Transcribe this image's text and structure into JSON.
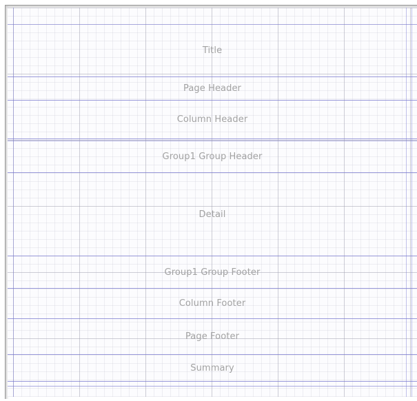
{
  "designer": {
    "bands": [
      {
        "id": "title",
        "label": "Title"
      },
      {
        "id": "page-header",
        "label": "Page Header"
      },
      {
        "id": "column-header",
        "label": "Column Header"
      },
      {
        "id": "group1-group-header",
        "label": "Group1 Group Header"
      },
      {
        "id": "detail",
        "label": "Detail"
      },
      {
        "id": "group1-group-footer",
        "label": "Group1 Group Footer"
      },
      {
        "id": "column-footer",
        "label": "Column Footer"
      },
      {
        "id": "page-footer",
        "label": "Page Footer"
      },
      {
        "id": "summary",
        "label": "Summary"
      }
    ]
  }
}
